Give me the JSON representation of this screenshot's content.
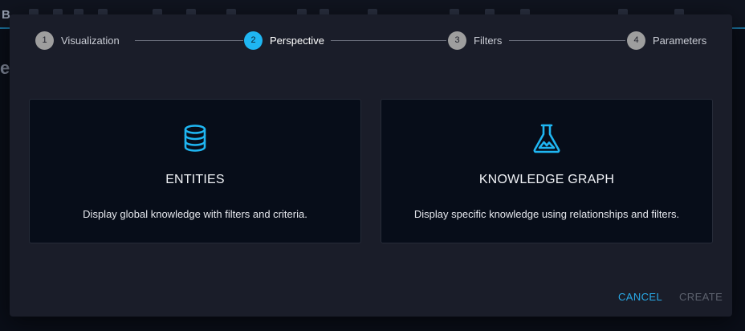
{
  "background": {
    "partial_letter_top": "B",
    "partial_letter_left": "e"
  },
  "stepper": {
    "steps": [
      {
        "number": "1",
        "label": "Visualization",
        "state": "done"
      },
      {
        "number": "2",
        "label": "Perspective",
        "state": "active"
      },
      {
        "number": "3",
        "label": "Filters",
        "state": "pending"
      },
      {
        "number": "4",
        "label": "Parameters",
        "state": "pending"
      }
    ]
  },
  "cards": [
    {
      "icon": "database-icon",
      "title": "ENTITIES",
      "description": "Display global knowledge with filters and criteria."
    },
    {
      "icon": "flask-icon",
      "title": "KNOWLEDGE GRAPH",
      "description": "Display specific knowledge using relationships and filters."
    }
  ],
  "actions": {
    "cancel_label": "CANCEL",
    "create_label": "CREATE",
    "create_enabled": false
  },
  "colors": {
    "accent": "#1fb6f2",
    "dialog_bg": "#1a1d29",
    "card_bg": "#070d19",
    "step_inactive": "#9e9e9e",
    "disabled_text": "#5c616d"
  }
}
